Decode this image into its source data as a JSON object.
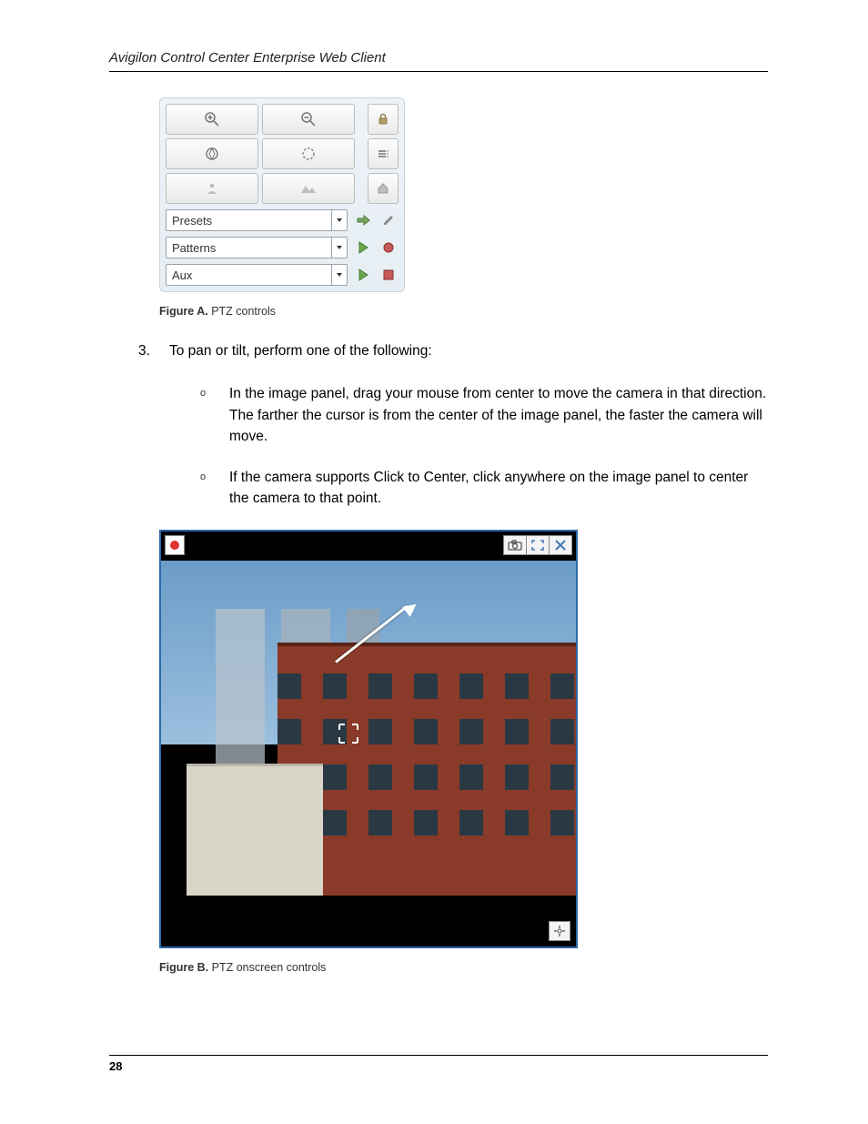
{
  "header": {
    "title": "Avigilon Control Center Enterprise Web Client"
  },
  "ptz": {
    "dropdowns": {
      "presets": "Presets",
      "patterns": "Patterns",
      "aux": "Aux"
    }
  },
  "captionA": {
    "label": "Figure A.",
    "text": " PTZ controls"
  },
  "step": {
    "num": "3.",
    "text": "To pan or tilt, perform one of the following:"
  },
  "bullets": {
    "a": "In the image panel, drag your mouse from center to move the camera in that direction. The farther the cursor is from the center of the image panel, the faster the camera will move.",
    "b": "If the camera supports Click to Center, click anywhere on the image panel to center the camera to that point."
  },
  "captionB": {
    "label": "Figure B.",
    "text": " PTZ onscreen controls"
  },
  "footer": {
    "page": "28"
  }
}
